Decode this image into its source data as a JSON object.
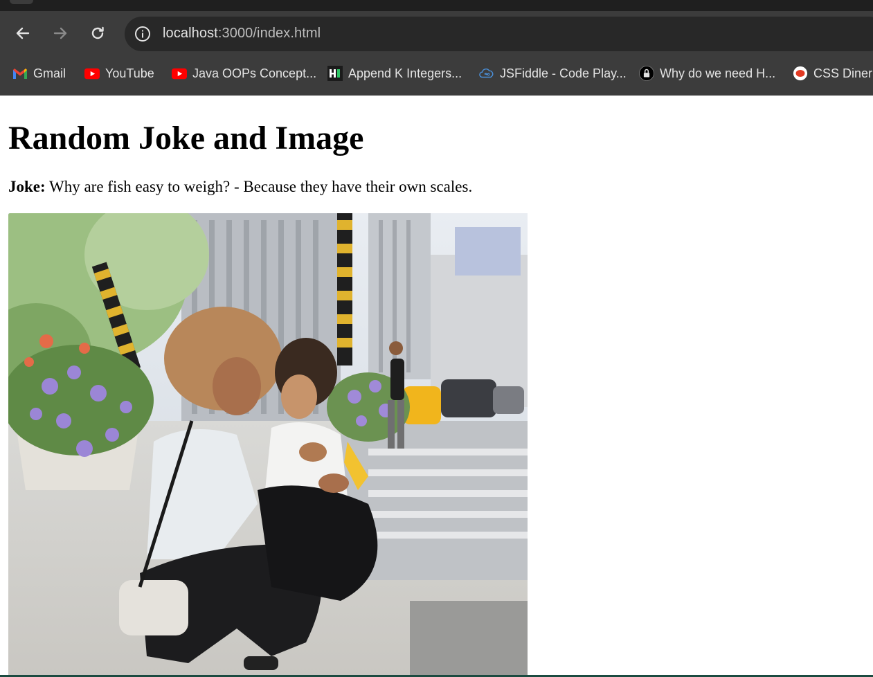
{
  "browser": {
    "url_host": "localhost",
    "url_path": ":3000/index.html",
    "bookmarks": [
      {
        "label": "Gmail",
        "icon": "gmail-icon"
      },
      {
        "label": "YouTube",
        "icon": "youtube-icon"
      },
      {
        "label": "Java OOPs Concept...",
        "icon": "youtube-icon"
      },
      {
        "label": "Append K Integers...",
        "icon": "hackerearth-icon"
      },
      {
        "label": "JSFiddle - Code Play...",
        "icon": "jsfiddle-icon"
      },
      {
        "label": "Why do we need H...",
        "icon": "lock-icon"
      },
      {
        "label": "CSS Diner",
        "icon": "css-diner-icon"
      }
    ]
  },
  "page": {
    "title": "Random Joke and Image",
    "joke_label": "Joke:",
    "joke_text": " Why are fish easy to weigh? - Because they have their own scales.",
    "image_description": "mother-and-child-photo"
  },
  "colors": {
    "chrome_bg": "#3c3c3c",
    "omnibox_bg": "#282828",
    "youtube_red": "#ff0000"
  }
}
